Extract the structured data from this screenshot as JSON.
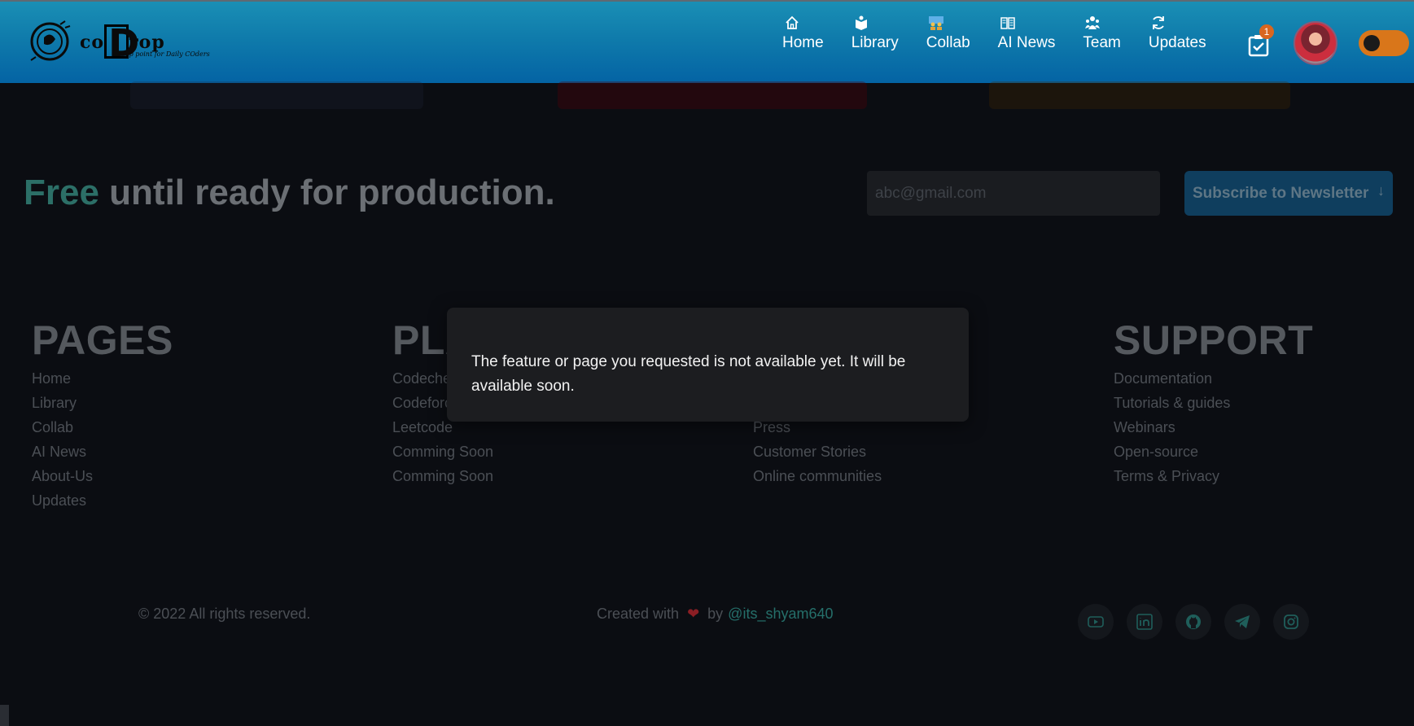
{
  "brand": {
    "name_prefix": "co",
    "name_d": "D",
    "name_suffix": "rop",
    "tagline": "rop point for Daily COders"
  },
  "nav": {
    "items": [
      {
        "label": "Home",
        "icon": "home-icon"
      },
      {
        "label": "Library",
        "icon": "book-icon"
      },
      {
        "label": "Collab",
        "icon": "collab-icon"
      },
      {
        "label": "AI News",
        "icon": "news-icon"
      },
      {
        "label": "Team",
        "icon": "team-icon"
      },
      {
        "label": "Updates",
        "icon": "refresh-icon"
      }
    ],
    "task_badge": "1"
  },
  "hero": {
    "free": "Free",
    "rest": " until ready for production.",
    "email_placeholder": "abc@gmail.com",
    "subscribe_label": "Subscribe to Newsletter"
  },
  "footer": {
    "columns": [
      {
        "title": "PAGES",
        "items": [
          "Home",
          "Library",
          "Collab",
          "AI News",
          "About-Us",
          "Updates"
        ]
      },
      {
        "title": "PLA",
        "items": [
          "Codeche",
          "Codeforc",
          "Leetcode",
          "Comming Soon",
          "Comming Soon"
        ]
      },
      {
        "title": "",
        "items": [
          "",
          "",
          "Press",
          "Customer Stories",
          "Online communities"
        ]
      },
      {
        "title": "SUPPORT",
        "items": [
          "Documentation",
          "Tutorials & guides",
          "Webinars",
          "Open-source",
          "Terms & Privacy"
        ]
      }
    ],
    "copyright": "© 2022 All rights reserved.",
    "created_with": "Created with",
    "by": "by",
    "handle": "@its_shyam640",
    "social": [
      "youtube-icon",
      "linkedin-icon",
      "github-icon",
      "telegram-icon",
      "instagram-icon"
    ]
  },
  "modal": {
    "message": "The feature or page you requested is not available yet. It will be available soon."
  },
  "colors": {
    "nav_top": "#1a8fb5",
    "nav_bottom": "#0463a4",
    "accent_teal": "#2c6f67",
    "toggle": "#d9761a",
    "badge": "#d9661f"
  }
}
